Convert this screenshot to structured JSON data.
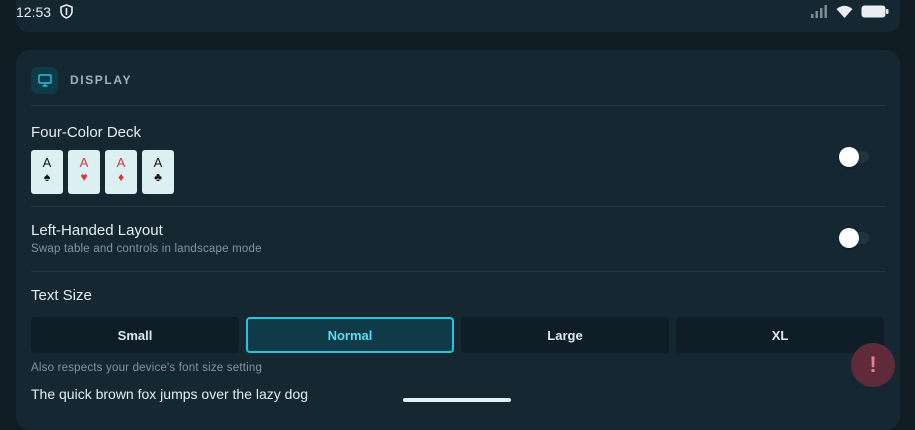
{
  "status_bar": {
    "time": "12:53"
  },
  "section": {
    "title": "DISPLAY"
  },
  "four_color_deck": {
    "title": "Four-Color Deck",
    "enabled": false,
    "cards": [
      {
        "rank": "A",
        "suit": "♠",
        "color": "#111111"
      },
      {
        "rank": "A",
        "suit": "♥",
        "color": "#d7373a"
      },
      {
        "rank": "A",
        "suit": "♦",
        "color": "#d7373a"
      },
      {
        "rank": "A",
        "suit": "♣",
        "color": "#111111"
      }
    ]
  },
  "left_handed": {
    "title": "Left-Handed Layout",
    "subtitle": "Swap table and controls in landscape mode",
    "enabled": false
  },
  "text_size": {
    "title": "Text Size",
    "options": [
      "Small",
      "Normal",
      "Large",
      "XL"
    ],
    "selected": "Normal",
    "note": "Also respects your device's font size setting",
    "preview": "The quick brown fox jumps over the lazy dog"
  },
  "feedback_button": {
    "label": "!"
  },
  "colors": {
    "accent": "#27c4de",
    "panel": "#152731",
    "background": "#0f1c24"
  }
}
